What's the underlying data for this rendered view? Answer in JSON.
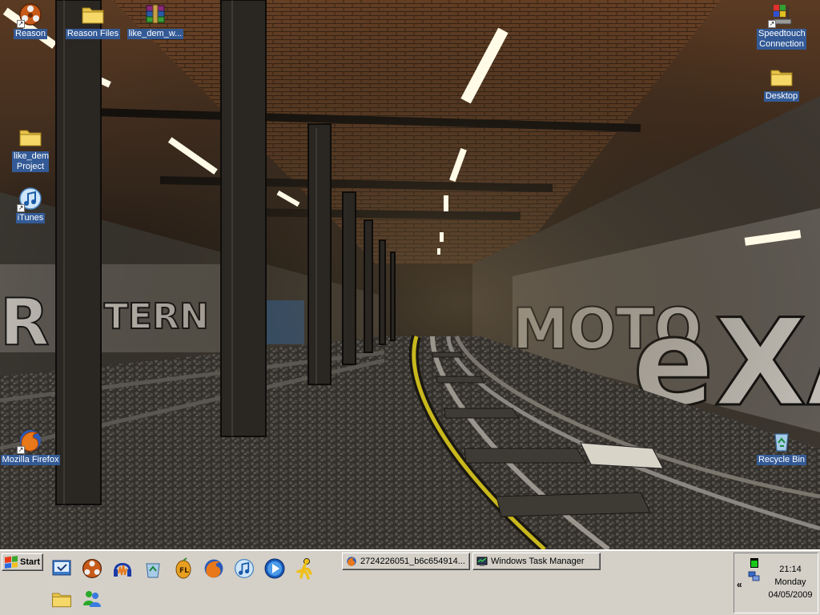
{
  "desktop": {
    "icons": [
      {
        "label": "Reason",
        "icon": "reason-icon"
      },
      {
        "label": "Reason Files",
        "icon": "folder-icon"
      },
      {
        "label": "like_dem_w...",
        "icon": "winrar-archive-icon"
      },
      {
        "label": "like_dem Project",
        "icon": "folder-icon"
      },
      {
        "label": "iTunes",
        "icon": "itunes-icon"
      },
      {
        "label": "Mozilla Firefox",
        "icon": "firefox-icon"
      },
      {
        "label": "Speedtouch Connection",
        "icon": "speedtouch-icon"
      },
      {
        "label": "Desktop",
        "icon": "folder-icon"
      },
      {
        "label": "Recycle Bin",
        "icon": "recycle-bin-icon"
      }
    ]
  },
  "taskbar": {
    "start_label": "Start",
    "quick_launch": [
      "show-desktop-icon",
      "reason-icon",
      "audacity-icon",
      "recycle-icon",
      "fl-studio-icon",
      "firefox-icon",
      "itunes-icon",
      "media-player-icon",
      "aim-icon",
      "folder-icon",
      "messenger-icon"
    ],
    "tasks": [
      {
        "label": "2724226051_b6c654914...",
        "icon": "firefox-icon"
      },
      {
        "label": "Windows Task Manager",
        "icon": "task-manager-icon"
      }
    ],
    "tray": {
      "chevron": "«",
      "time": "21:14",
      "day": "Monday",
      "date": "04/05/2009"
    }
  }
}
